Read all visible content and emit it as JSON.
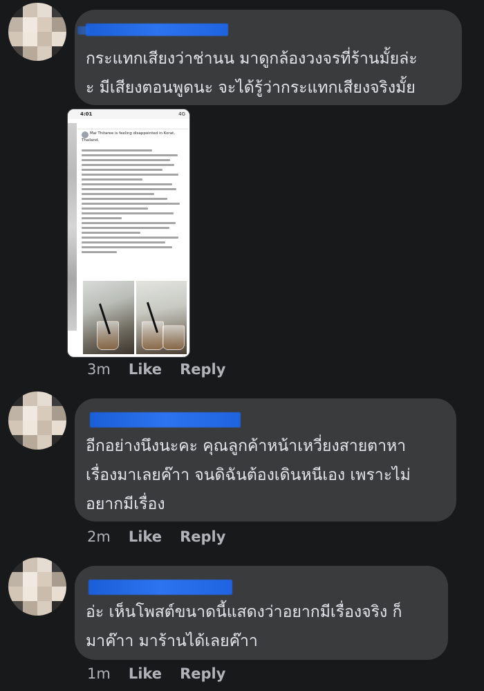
{
  "comments": [
    {
      "text_line1": "กระแทกเสียงว่าช่านน มาดูกล้องวงจรที่ร้านมั้ยล่ะ",
      "text_line2": "ะ มีเสียงตอนพูดนะ จะได้รู้ว่ากระแทกเสียงจริงมั้ย",
      "time": "3m",
      "like_label": "Like",
      "reply_label": "Reply"
    },
    {
      "text_line1": "อีกอย่างนึงนะคะ คุณลูกค้าหน้าเหวี่ยงสายตาหา",
      "text_line2": "เรื่องมาเลยค๊าา จนดิฉันต้องเดินหนีเอง เพราะไม่",
      "text_line3": "อยากมีเรื่อง",
      "time": "2m",
      "like_label": "Like",
      "reply_label": "Reply"
    },
    {
      "text_line1": "อ่ะ เห็นโพสต์ขนาดนี้แสดงว่าอยากมีเรื่องจริง ก็",
      "text_line2": "มาค๊าา มาร้านได้เลยค๊าา",
      "time": "1m",
      "like_label": "Like",
      "reply_label": "Reply"
    }
  ],
  "attachment": {
    "status_time": "4:01",
    "status_signal": "4G",
    "author_line": "Mai Thitaree is feeling disappointed in Korat, Thailand."
  },
  "colors": {
    "background": "#18191a",
    "bubble": "#3a3b3c",
    "text": "#e4e6eb",
    "meta": "#b0b3b8",
    "name_redaction": "#1b5fd8"
  }
}
